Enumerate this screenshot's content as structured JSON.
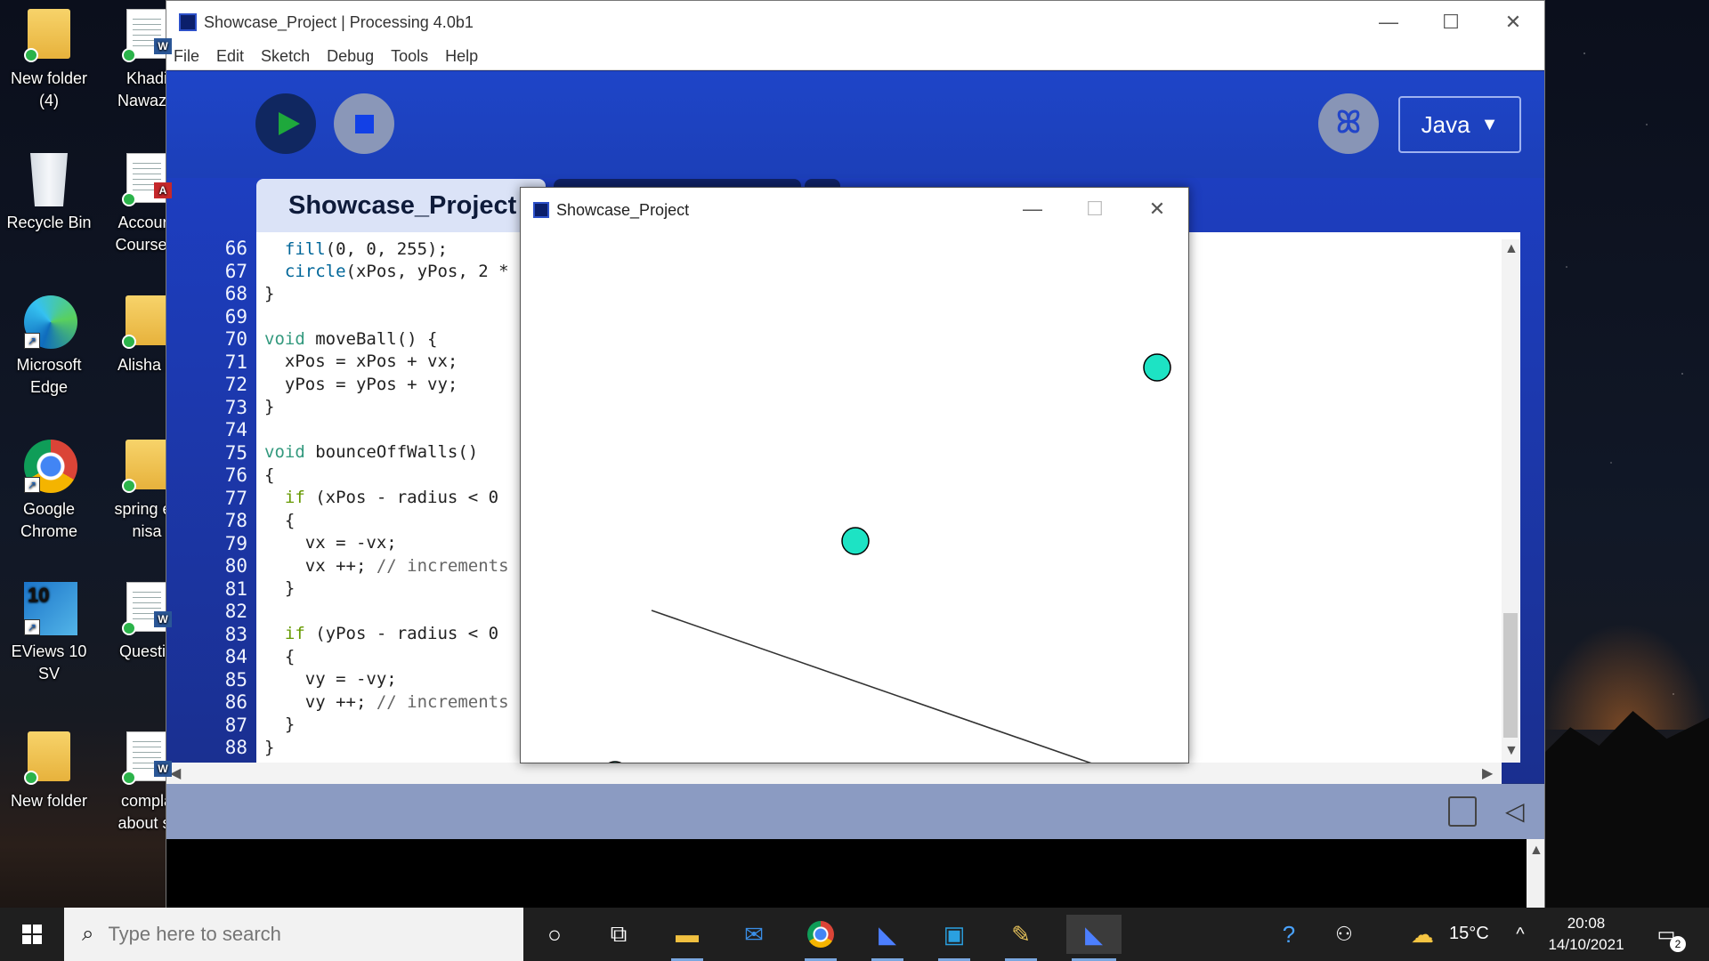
{
  "desktop": {
    "icons": [
      {
        "label": "New folder\n(4)"
      },
      {
        "label": "Khadi\nNawaz -"
      },
      {
        "label": "Recycle Bin"
      },
      {
        "label": "Account\nCoursew"
      },
      {
        "label": "Microsoft\nEdge"
      },
      {
        "label": "Alisha E"
      },
      {
        "label": "Google\nChrome"
      },
      {
        "label": "spring ex\nnisa"
      },
      {
        "label": "EViews 10 SV"
      },
      {
        "label": "Questio"
      },
      {
        "label": "New folder"
      },
      {
        "label": "compla\nabout sr"
      }
    ],
    "eviews_badge": "10"
  },
  "processing": {
    "window_title": "Showcase_Project | Processing 4.0b1",
    "menu": [
      "File",
      "Edit",
      "Sketch",
      "Debug",
      "Tools",
      "Help"
    ],
    "mode": "Java",
    "mode_arrow": "▼",
    "tab_active": "Showcase_Project",
    "line_numbers": [
      "66",
      "67",
      "68",
      "69",
      "70",
      "71",
      "72",
      "73",
      "74",
      "75",
      "76",
      "77",
      "78",
      "79",
      "80",
      "81",
      "82",
      "83",
      "84",
      "85",
      "86",
      "87",
      "88"
    ],
    "code": {
      "l66": [
        "  ",
        "fill",
        "(0, 0, 255);"
      ],
      "l67": [
        "  ",
        "circle",
        "(xPos, yPos, 2 *"
      ],
      "l68": "}",
      "l70": [
        "void",
        " ",
        "moveBall",
        "() {"
      ],
      "l71": "  xPos = xPos + vx;",
      "l72": "  yPos = yPos + vy;",
      "l73": "}",
      "l75": [
        "void",
        " bounceOffWalls()"
      ],
      "l76": "{",
      "l77": [
        "  ",
        "if",
        " (xPos - radius < 0"
      ],
      "l78": "  {",
      "l79": "    vx = -vx;",
      "l80": [
        "    vx ++; ",
        "// increments"
      ],
      "l81": "  }",
      "l83": [
        "  ",
        "if",
        " (yPos - radius < 0"
      ],
      "l84": "  {",
      "l85": "    vy = -vy;",
      "l86": [
        "    vy ++; ",
        "// increments"
      ],
      "l87": "  }",
      "l88": "}"
    }
  },
  "sketch_window": {
    "title": "Showcase_Project",
    "balls_color": "#1de3c4",
    "main_ball_color": "#0000ff"
  },
  "taskbar": {
    "search_placeholder": "Type here to search",
    "temperature": "15°C",
    "time": "20:08",
    "date": "14/10/2021",
    "notification_count": "2"
  }
}
